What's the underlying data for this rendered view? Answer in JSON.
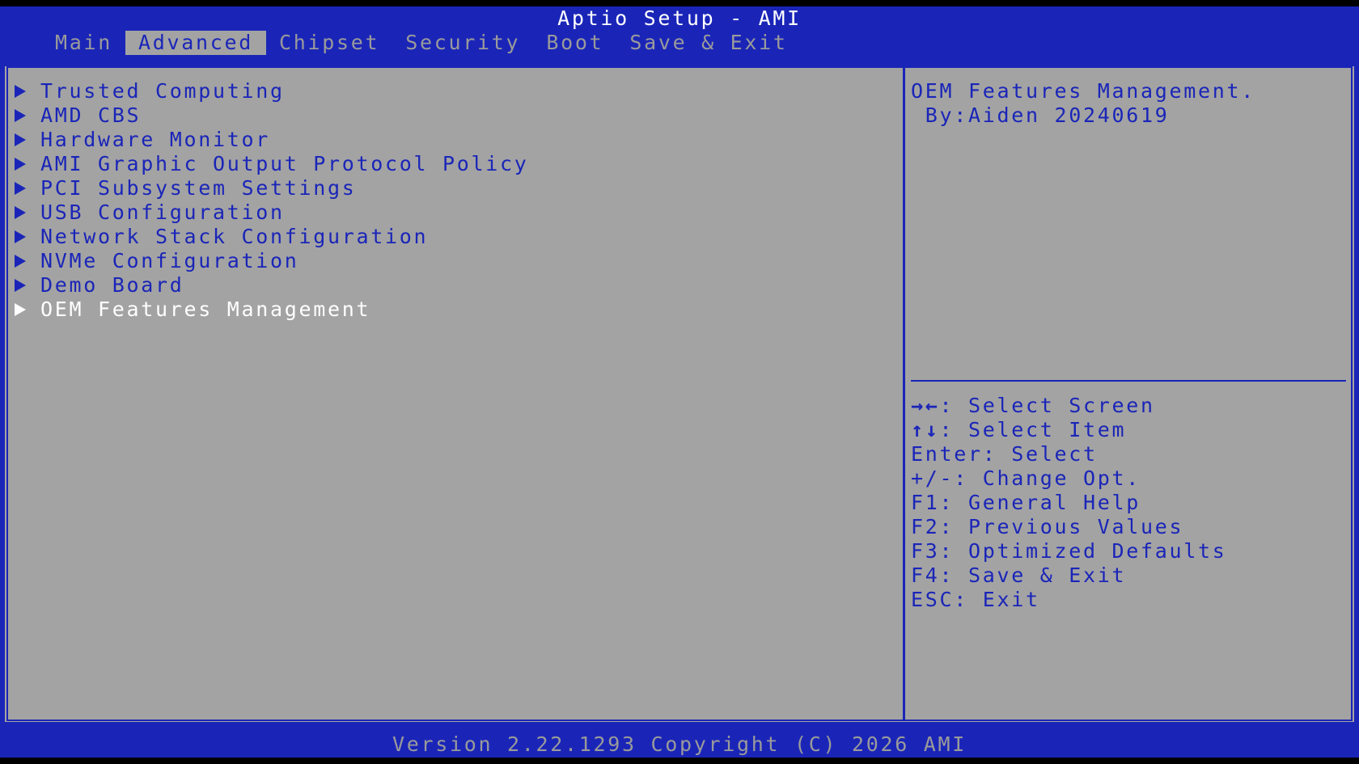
{
  "header": {
    "title": "Aptio Setup - AMI",
    "tabs": [
      {
        "label": "Main"
      },
      {
        "label": "Advanced"
      },
      {
        "label": "Chipset"
      },
      {
        "label": "Security"
      },
      {
        "label": "Boot"
      },
      {
        "label": "Save & Exit"
      }
    ],
    "active_tab": "Advanced"
  },
  "menu": {
    "items": [
      {
        "label": "Trusted Computing"
      },
      {
        "label": "AMD CBS"
      },
      {
        "label": "Hardware Monitor"
      },
      {
        "label": "AMI Graphic Output Protocol Policy"
      },
      {
        "label": "PCI Subsystem Settings"
      },
      {
        "label": "USB Configuration"
      },
      {
        "label": "Network Stack Configuration"
      },
      {
        "label": "NVMe Configuration"
      },
      {
        "label": "Demo Board"
      },
      {
        "label": "OEM Features Management"
      }
    ],
    "selected": "OEM Features Management"
  },
  "help": {
    "lines": [
      "OEM Features Management.",
      " By:Aiden 20240619"
    ]
  },
  "keys": [
    {
      "key": "→←",
      "desc": ": Select Screen"
    },
    {
      "key": "↑↓",
      "desc": ": Select Item"
    },
    {
      "key": "Enter",
      "desc": ": Select"
    },
    {
      "key": "+/-",
      "desc": ": Change Opt."
    },
    {
      "key": "F1",
      "desc": ": General Help"
    },
    {
      "key": "F2",
      "desc": ": Previous Values"
    },
    {
      "key": "F3",
      "desc": ": Optimized Defaults"
    },
    {
      "key": "F4",
      "desc": ": Save & Exit"
    },
    {
      "key": "ESC",
      "desc": ": Exit"
    }
  ],
  "footer": {
    "text": "Version 2.22.1293 Copyright (C) 2026 AMI"
  },
  "colors": {
    "bios_blue": "#1a25b8",
    "panel_gray": "#a3a3a3",
    "inactive_text": "#9a9a9a",
    "highlight_text": "#ffffff"
  }
}
